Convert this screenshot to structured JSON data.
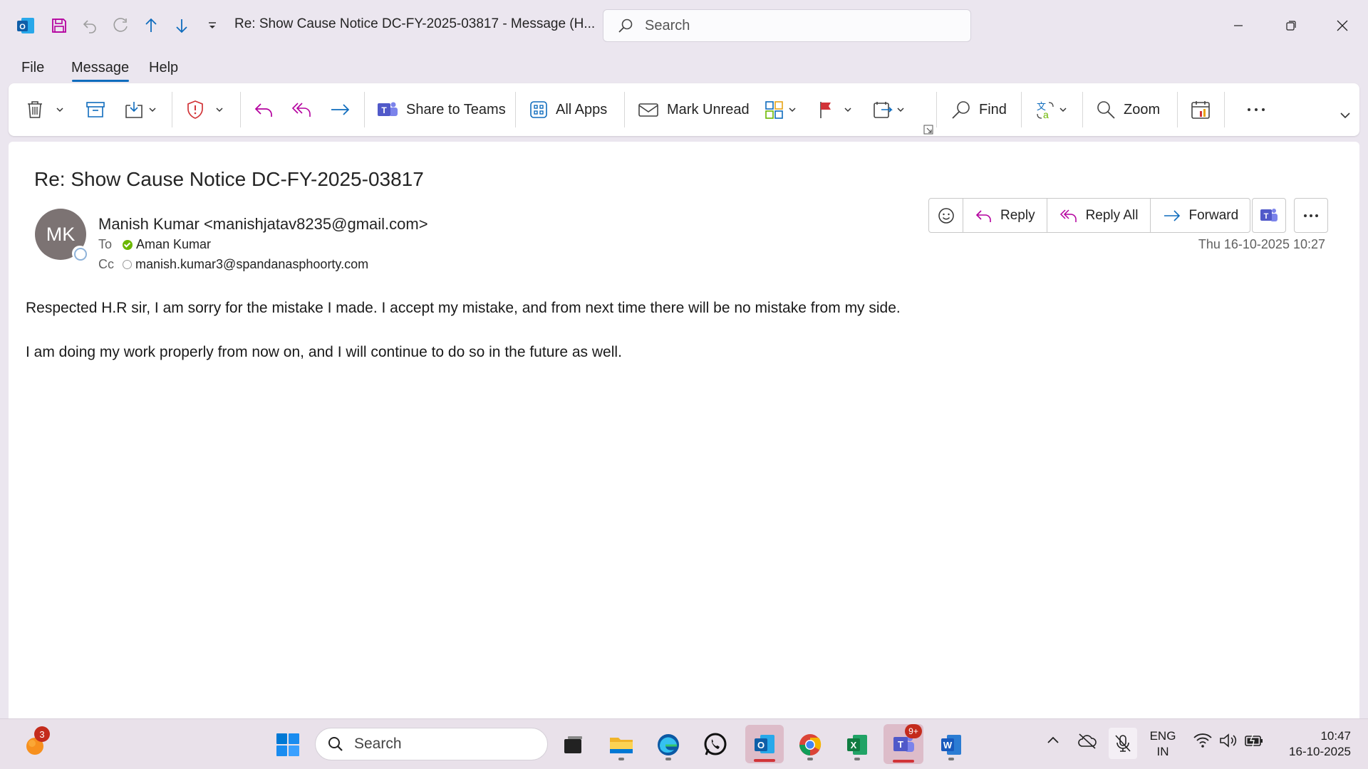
{
  "window": {
    "title": "Re: Show Cause Notice DC-FY-2025-03817  -  Message (H...",
    "search_placeholder": "Search"
  },
  "menu": {
    "tabs": [
      "File",
      "Message",
      "Help"
    ],
    "active": "Message"
  },
  "ribbon": {
    "share_teams": "Share to Teams",
    "all_apps": "All Apps",
    "mark_unread": "Mark Unread",
    "find": "Find",
    "zoom": "Zoom"
  },
  "email": {
    "subject": "Re: Show Cause Notice DC-FY-2025-03817",
    "avatar_initials": "MK",
    "sender": "Manish Kumar <manishjatav8235@gmail.com>",
    "to_label": "To",
    "to": "Aman Kumar",
    "cc_label": "Cc",
    "cc": "manish.kumar3@spandanasphoorty.com",
    "date": "Thu 16-10-2025 10:27",
    "actions": {
      "reply": "Reply",
      "reply_all": "Reply All",
      "forward": "Forward"
    },
    "body": [
      "Respected H.R sir, I am sorry for the mistake I made. I accept my mistake, and from next time there will be no mistake from my side.",
      "I am doing my work properly from now on, and I will continue to do so in the future as well."
    ]
  },
  "taskbar": {
    "search_placeholder": "Search",
    "widget_badge": "3",
    "teams_badge": "9+",
    "lang_line1": "ENG",
    "lang_line2": "IN",
    "time": "10:47",
    "date": "16-10-2025"
  },
  "colors": {
    "accent": "#0f6cbd",
    "avatar_bg": "#7c7373",
    "presence_available": "#6bb700",
    "badge": "#c42b1c"
  }
}
